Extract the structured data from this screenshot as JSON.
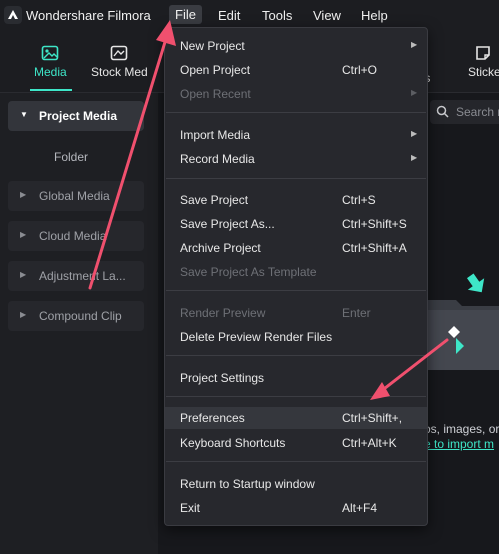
{
  "app": {
    "name": "Wondershare Filmora",
    "logo_icon": "filmora-logo-icon"
  },
  "menubar": {
    "items": [
      "File",
      "Edit",
      "Tools",
      "View",
      "Help"
    ],
    "active": "File"
  },
  "toolbar": {
    "items": [
      {
        "label": "Media",
        "icon": "media-icon",
        "active": true
      },
      {
        "label": "Stock Med",
        "icon": "stock-media-icon",
        "active": false
      },
      {
        "label": "ts",
        "icon": "",
        "active": false
      },
      {
        "label": "Sticke",
        "icon": "sticker-icon",
        "active": false
      }
    ],
    "accent_color": "#3ee6c8"
  },
  "left_panel": {
    "project_media": "Project Media",
    "folder": "Folder",
    "items": [
      "Global Media",
      "Cloud Media",
      "Adjustment La...",
      "Compound Clip"
    ]
  },
  "search": {
    "placeholder": "Search m"
  },
  "main": {
    "hint_line1": "os, images, or",
    "hint_line2": "e to import m"
  },
  "file_menu": {
    "items": [
      {
        "label": "New Project",
        "shortcut": "",
        "submenu": true,
        "disabled": false
      },
      {
        "label": "Open Project",
        "shortcut": "Ctrl+O",
        "submenu": false,
        "disabled": false
      },
      {
        "label": "Open Recent",
        "shortcut": "",
        "submenu": true,
        "disabled": true
      },
      {
        "label": "Import Media",
        "shortcut": "",
        "submenu": true,
        "disabled": false
      },
      {
        "label": "Record Media",
        "shortcut": "",
        "submenu": true,
        "disabled": false
      },
      {
        "label": "Save Project",
        "shortcut": "Ctrl+S",
        "submenu": false,
        "disabled": false
      },
      {
        "label": "Save Project As...",
        "shortcut": "Ctrl+Shift+S",
        "submenu": false,
        "disabled": false
      },
      {
        "label": "Archive Project",
        "shortcut": "Ctrl+Shift+A",
        "submenu": false,
        "disabled": false
      },
      {
        "label": "Save Project As Template",
        "shortcut": "",
        "submenu": false,
        "disabled": true
      },
      {
        "label": "Render Preview",
        "shortcut": "Enter",
        "submenu": false,
        "disabled": true
      },
      {
        "label": "Delete Preview Render Files",
        "shortcut": "",
        "submenu": false,
        "disabled": false
      },
      {
        "label": "Project Settings",
        "shortcut": "",
        "submenu": false,
        "disabled": false
      },
      {
        "label": "Preferences",
        "shortcut": "Ctrl+Shift+,",
        "submenu": false,
        "disabled": false,
        "highlighted": true
      },
      {
        "label": "Keyboard Shortcuts",
        "shortcut": "Ctrl+Alt+K",
        "submenu": false,
        "disabled": false
      },
      {
        "label": "Return to Startup window",
        "shortcut": "",
        "submenu": false,
        "disabled": false
      },
      {
        "label": "Exit",
        "shortcut": "Alt+F4",
        "submenu": false,
        "disabled": false
      }
    ]
  },
  "annotation_color": "#f0506e"
}
